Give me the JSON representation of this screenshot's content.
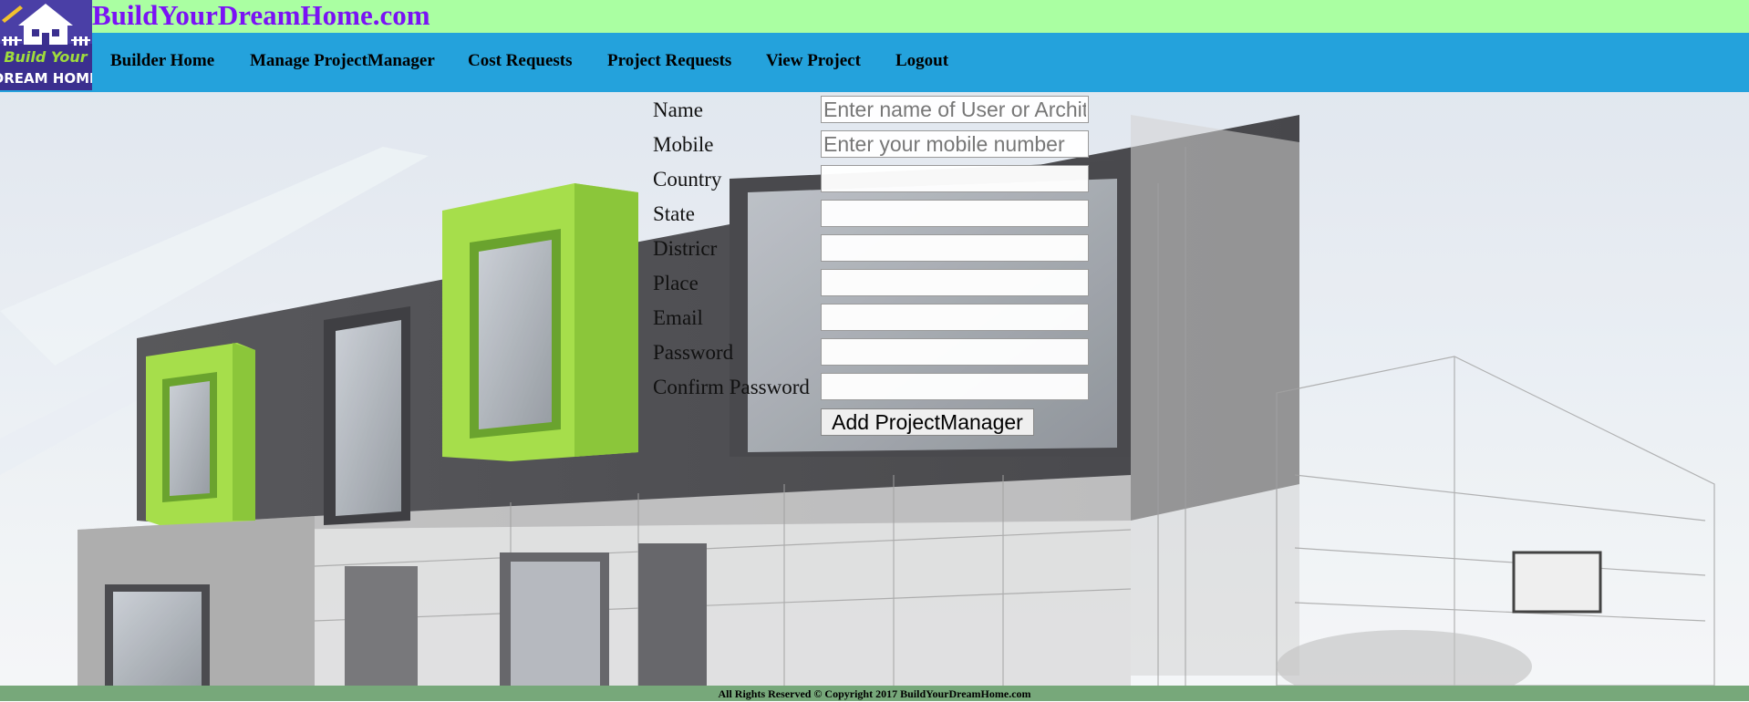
{
  "header": {
    "site_title": "BuildYourDreamHome.com",
    "logo": {
      "line1": "Build Your",
      "line2": "DREAM HOME",
      "icon": "house-logo-icon"
    }
  },
  "nav": {
    "items": [
      {
        "label": "Builder Home"
      },
      {
        "label": "Manage ProjectManager"
      },
      {
        "label": "Cost Requests"
      },
      {
        "label": "Project Requests"
      },
      {
        "label": "View Project"
      },
      {
        "label": "Logout"
      }
    ]
  },
  "form": {
    "fields": [
      {
        "label": "Name",
        "placeholder": "Enter name of User or Architect",
        "value": ""
      },
      {
        "label": "Mobile",
        "placeholder": "Enter your mobile number",
        "value": ""
      },
      {
        "label": "Country",
        "placeholder": "",
        "value": ""
      },
      {
        "label": "State",
        "placeholder": "",
        "value": ""
      },
      {
        "label": "Districr",
        "placeholder": "",
        "value": ""
      },
      {
        "label": "Place",
        "placeholder": "",
        "value": ""
      },
      {
        "label": "Email",
        "placeholder": "",
        "value": ""
      },
      {
        "label": "Password",
        "placeholder": "",
        "value": ""
      },
      {
        "label": "Confirm Password",
        "placeholder": "",
        "value": ""
      }
    ],
    "submit_label": "Add ProjectManager"
  },
  "footer": {
    "text": "All Rights Reserved © Copyright 2017 BuildYourDreamHome.com"
  },
  "colors": {
    "title_bar": "#aaffa2",
    "title_text": "#7a12f5",
    "nav_bar": "#24a2dc",
    "footer_bar": "#77a87a",
    "accent_green": "#9fdc3c"
  }
}
